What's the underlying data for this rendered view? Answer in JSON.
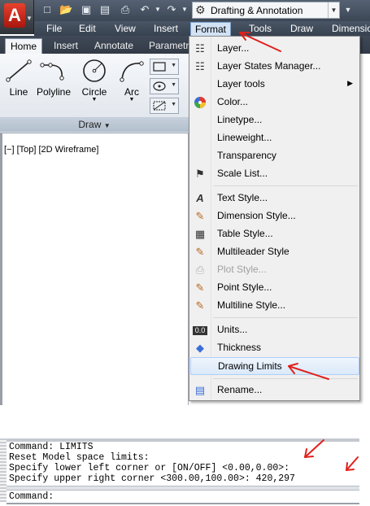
{
  "colors": {
    "titlebar": "#4a5565",
    "menu_hover": "#dbe9f9",
    "annotation": "#e0201c"
  },
  "titlebar": {
    "app_letter": "A",
    "workspace": "Drafting & Annotation",
    "quick_access_icons": [
      "new-icon",
      "open-icon",
      "save-icon",
      "save-as-icon",
      "print-icon",
      "undo-icon",
      "redo-icon"
    ]
  },
  "menubar": {
    "items": [
      "File",
      "Edit",
      "View",
      "Insert",
      "Format",
      "Tools",
      "Draw",
      "Dimension"
    ]
  },
  "ribbon": {
    "tabs": [
      "Home",
      "Insert",
      "Annotate",
      "Parametr"
    ],
    "tools": [
      "Line",
      "Polyline",
      "Circle",
      "Arc"
    ],
    "panel_title": "Draw"
  },
  "viewport": {
    "label": "[−] [Top] [2D Wireframe]"
  },
  "format_menu": {
    "items": [
      {
        "label": "Layer...",
        "icon": "layer-icon"
      },
      {
        "label": "Layer States Manager...",
        "icon": "layer-states-icon"
      },
      {
        "label": "Layer tools",
        "icon": "",
        "submenu": "▶"
      },
      {
        "label": "Color...",
        "icon": "color-wheel-icon"
      },
      {
        "label": "Linetype...",
        "icon": ""
      },
      {
        "label": "Lineweight...",
        "icon": ""
      },
      {
        "label": "Transparency",
        "icon": ""
      },
      {
        "label": "Scale List...",
        "icon": "scale-list-icon"
      },
      {
        "label": "Text Style...",
        "icon": "text-style-icon"
      },
      {
        "label": "Dimension Style...",
        "icon": "dimension-style-icon"
      },
      {
        "label": "Table Style...",
        "icon": "table-style-icon"
      },
      {
        "label": "Multileader Style",
        "icon": "multileader-style-icon"
      },
      {
        "label": "Plot Style...",
        "icon": "plot-style-icon"
      },
      {
        "label": "Point Style...",
        "icon": "point-style-icon"
      },
      {
        "label": "Multiline Style...",
        "icon": "multiline-style-icon"
      },
      {
        "label": "Units...",
        "icon": "units-icon"
      },
      {
        "label": "Thickness",
        "icon": "thickness-icon"
      },
      {
        "label": "Drawing Limits",
        "icon": ""
      },
      {
        "label": "Rename...",
        "icon": "rename-icon"
      }
    ]
  },
  "command": {
    "history": [
      "Command: LIMITS",
      "Reset Model space limits:",
      "Specify lower left corner or [ON/OFF] <0.00,0.00>:",
      "Specify upper right corner <300.00,100.00>: 420,297"
    ],
    "prompt": "Command:"
  }
}
